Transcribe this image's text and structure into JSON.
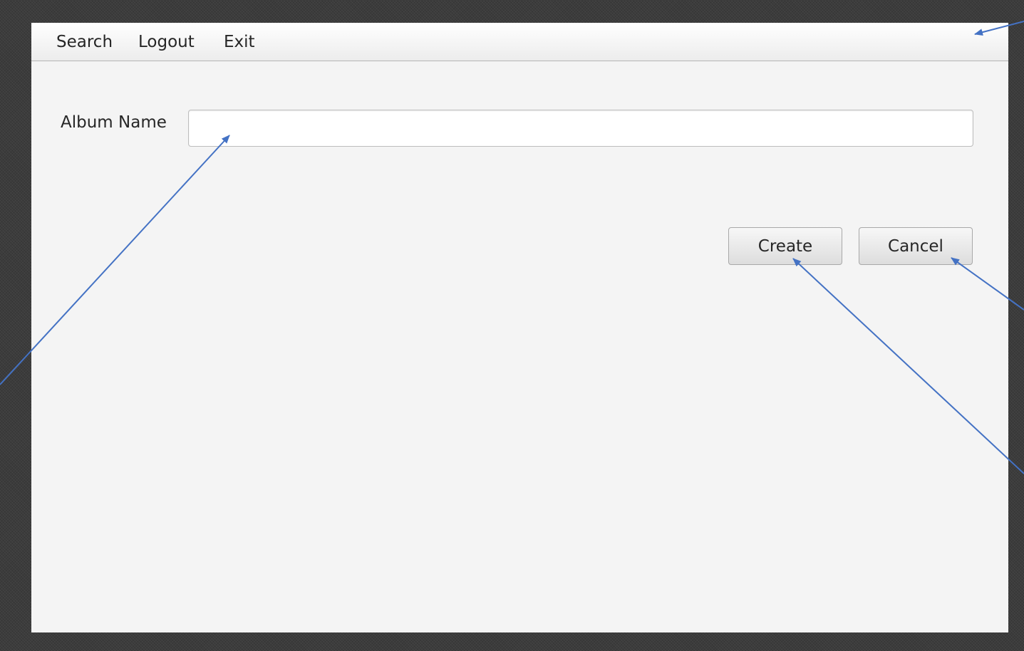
{
  "menu": {
    "items": [
      {
        "label": "Search"
      },
      {
        "label": "Logout"
      },
      {
        "label": "Exit"
      }
    ]
  },
  "form": {
    "album_name_label": "Album Name",
    "album_name_value": "",
    "album_name_placeholder": ""
  },
  "buttons": {
    "create_label": "Create",
    "cancel_label": "Cancel"
  },
  "colors": {
    "window_background": "#f4f4f4",
    "backdrop": "#3c3c3c",
    "annotation_arrow": "#4472c4"
  }
}
